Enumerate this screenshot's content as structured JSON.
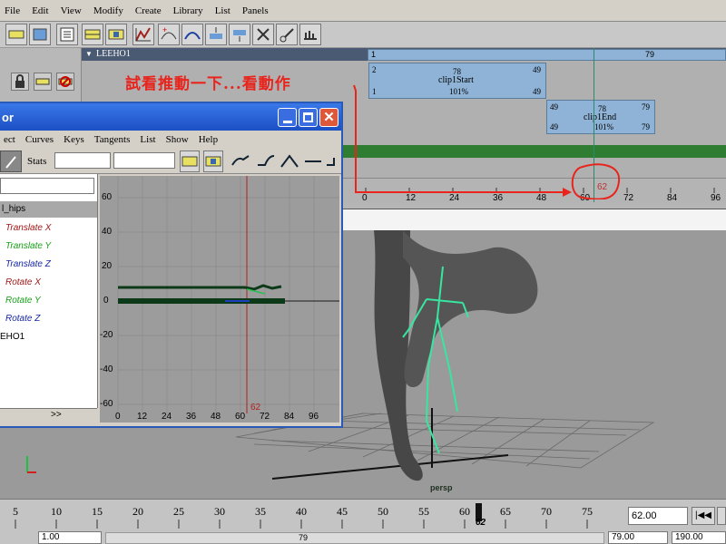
{
  "menubar": {
    "items": [
      "File",
      "Edit",
      "View",
      "Modify",
      "Create",
      "Library",
      "List",
      "Panels"
    ]
  },
  "trax": {
    "character_name": "LEEHO1",
    "char_clip": {
      "start": "1",
      "end": "79"
    },
    "clip1": {
      "name": "clip1Start",
      "start": "1",
      "start_top": "2",
      "mid": "78",
      "end_top": "49",
      "end": "49",
      "weight": "101%"
    },
    "clip2": {
      "name": "clip1End",
      "start_top": "49",
      "start": "49",
      "mid": "78",
      "end_top": "79",
      "end": "79",
      "weight": "101%"
    },
    "ruler_ticks": [
      "0",
      "12",
      "24",
      "36",
      "48",
      "60",
      "72",
      "84",
      "96"
    ],
    "current_time_marker": "62",
    "annotation": "試看推動一下...看動作"
  },
  "graph_editor": {
    "title": "or",
    "menu": [
      "ect",
      "Curves",
      "Keys",
      "Tangents",
      "List",
      "Show",
      "Help"
    ],
    "stats_label": "Stats",
    "outliner": {
      "header": "l_hips",
      "attributes": [
        {
          "label": "Translate X",
          "color": "#a01818"
        },
        {
          "label": "Translate Y",
          "color": "#18a018"
        },
        {
          "label": "Translate Z",
          "color": "#1828a0"
        },
        {
          "label": "Rotate X",
          "color": "#a01818"
        },
        {
          "label": "Rotate Y",
          "color": "#18a018"
        },
        {
          "label": "Rotate Z",
          "color": "#1828a0"
        }
      ],
      "character": "EHO1",
      "scroll_arrow": ">>"
    },
    "y_ticks": [
      "60",
      "40",
      "20",
      "0",
      "-20",
      "-40",
      "-60"
    ],
    "x_ticks": [
      "0",
      "12",
      "24",
      "36",
      "48",
      "60",
      "72",
      "84",
      "96"
    ],
    "current_time": "62"
  },
  "viewport": {
    "camera_label": "persp"
  },
  "time_slider": {
    "ticks": [
      "5",
      "10",
      "15",
      "20",
      "25",
      "30",
      "35",
      "40",
      "45",
      "50",
      "55",
      "60",
      "65",
      "70",
      "75"
    ],
    "current_frame": "62",
    "current_time_field": "62.00"
  },
  "range": {
    "start": "1.00",
    "slider_value": "79",
    "end": "79.00",
    "total_end": "190.00"
  },
  "colors": {
    "accent_red": "#e8241c",
    "clip_blue": "#8eb3d6",
    "skeleton_green": "#37e6a0"
  }
}
